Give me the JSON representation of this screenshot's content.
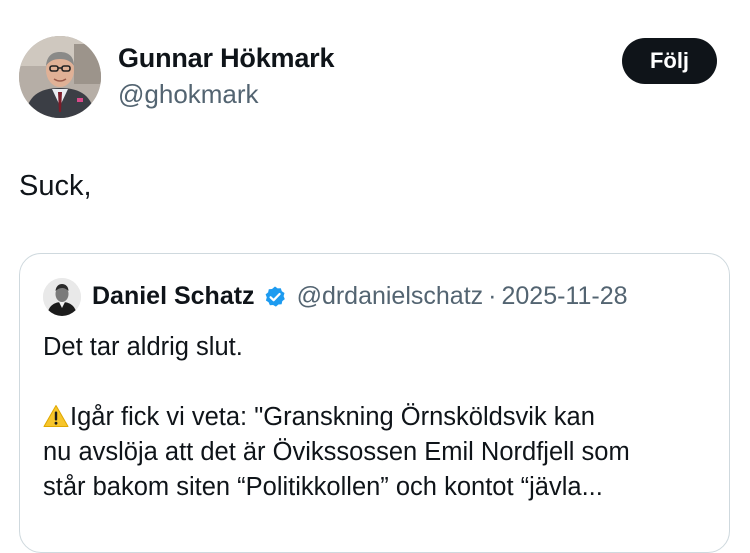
{
  "tweet": {
    "author": {
      "name": "Gunnar Hökmark",
      "handle": "@ghokmark",
      "avatar_icon": "person-avatar-photo"
    },
    "follow_label": "Följ",
    "text": "Suck,"
  },
  "quote": {
    "author": {
      "name": "Daniel Schatz",
      "handle": "@drdanielschatz",
      "separator": "·",
      "date": "2025-11-28",
      "verified": true,
      "verified_color": "#1d9bf0",
      "avatar_icon": "person-avatar-photo"
    },
    "lines": {
      "l1": "Det tar aldrig slut.",
      "l2_icon": "warning-icon",
      "l2": "Igår fick vi veta: \"Granskning Örnsköldsvik kan",
      "l3": "nu avslöja att det är Övikssossen Emil Nordfjell som",
      "l4": "står bakom siten “Politikkollen” och kontot “jävla..."
    }
  },
  "colors": {
    "text_primary": "#0f1419",
    "text_secondary": "#536471",
    "border": "#cfd9de",
    "button_bg": "#0f1419",
    "button_text": "#ffffff"
  }
}
